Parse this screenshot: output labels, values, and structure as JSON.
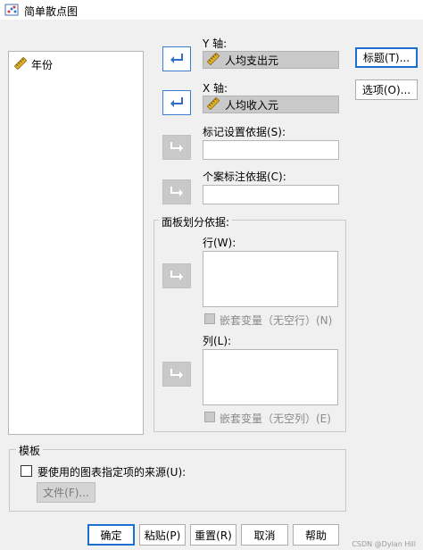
{
  "window": {
    "title": "简单散点图",
    "icon": "scatter-chart-icon"
  },
  "variables": {
    "items": [
      {
        "label": "年份",
        "icon": "ruler-scale-icon"
      }
    ]
  },
  "y_axis": {
    "label": "Y 轴:",
    "value": "人均支出元",
    "icon": "ruler-scale-icon"
  },
  "x_axis": {
    "label": "X 轴:",
    "value": "人均收入元",
    "icon": "ruler-scale-icon"
  },
  "set_markers": {
    "label": "标记设置依据(S):"
  },
  "label_cases": {
    "label": "个案标注依据(C):"
  },
  "panel": {
    "legend": "面板划分依据:",
    "rows_label": "行(W):",
    "rows_nest": "嵌套变量（无空行）(N)",
    "cols_label": "列(L):",
    "cols_nest": "嵌套变量（无空列）(E)"
  },
  "side_buttons": {
    "titles": "标题(T)...",
    "options": "选项(O)..."
  },
  "template": {
    "legend": "模板",
    "use_chart_label": "要使用的图表指定项的来源(U):",
    "file_button": "文件(F)..."
  },
  "footer": {
    "ok": "确定",
    "paste": "粘贴(P)",
    "reset": "重置(R)",
    "cancel": "取消",
    "help": "帮助"
  },
  "watermark": "CSDN @Dylan Hill",
  "colors": {
    "accent": "#1c6fd1",
    "arrow": "#2f6fca",
    "ruler": "#d4a017"
  }
}
